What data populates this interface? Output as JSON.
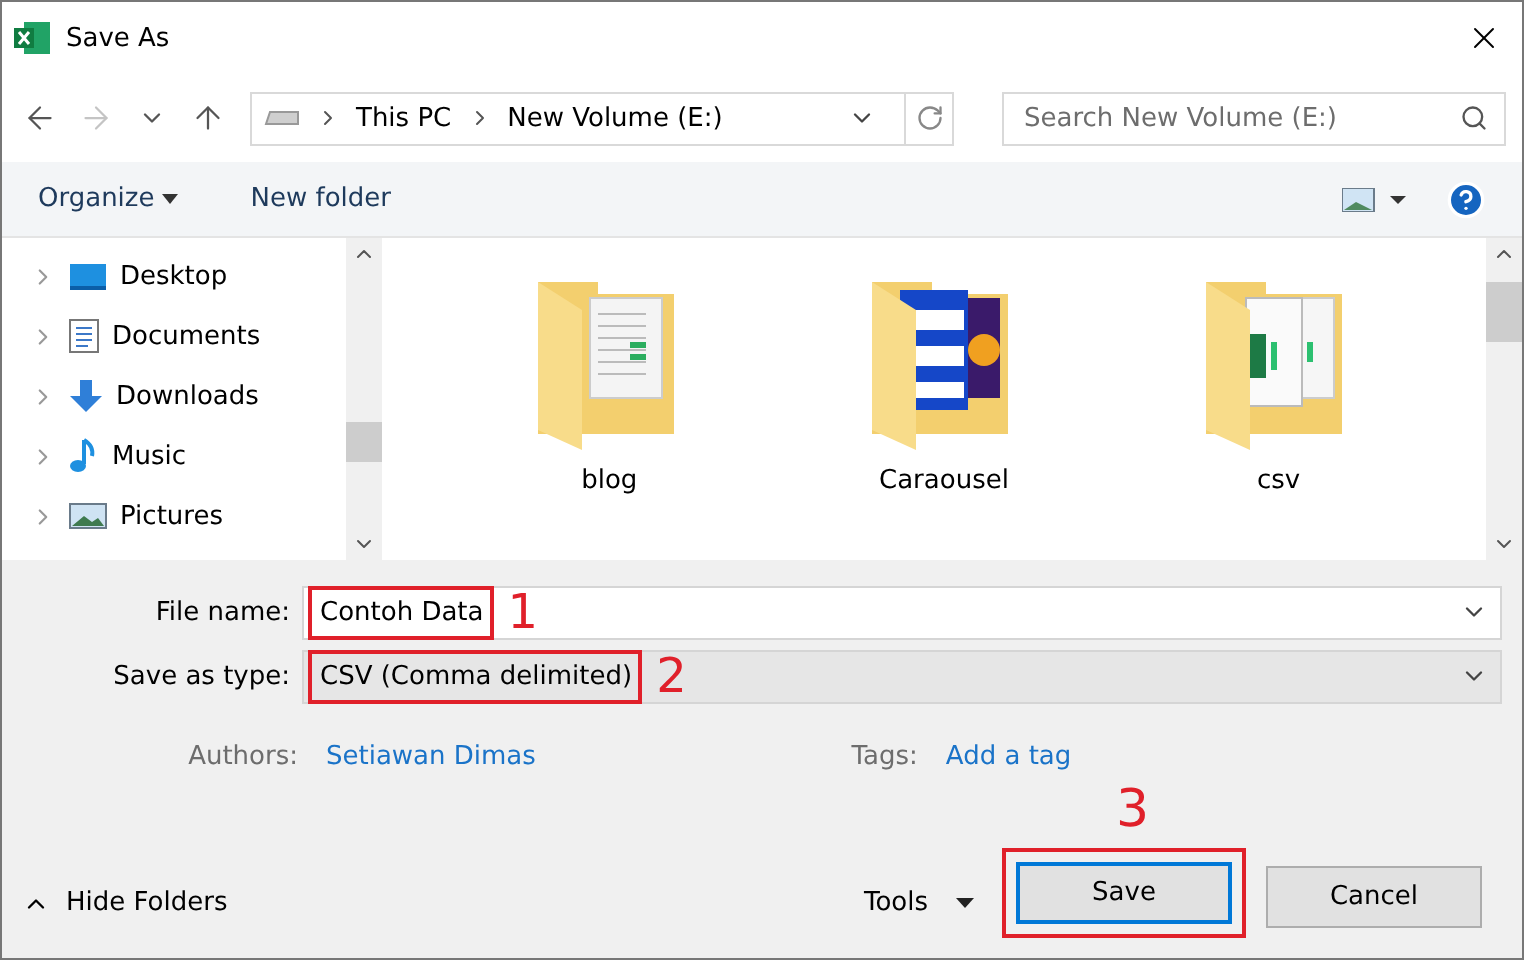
{
  "window": {
    "title": "Save As"
  },
  "navigation": {
    "forward_disabled": true,
    "path": [
      "This PC",
      "New Volume (E:)"
    ]
  },
  "search": {
    "placeholder": "Search New Volume (E:)"
  },
  "toolbar": {
    "organize": "Organize",
    "new_folder": "New folder"
  },
  "sidebar": {
    "items": [
      {
        "label": "Desktop",
        "kind": "desktop"
      },
      {
        "label": "Documents",
        "kind": "documents"
      },
      {
        "label": "Downloads",
        "kind": "downloads"
      },
      {
        "label": "Music",
        "kind": "music"
      },
      {
        "label": "Pictures",
        "kind": "pictures"
      }
    ]
  },
  "folders": [
    {
      "name": "blog",
      "kind": "document"
    },
    {
      "name": "Caraousel",
      "kind": "slides"
    },
    {
      "name": "csv",
      "kind": "spreadsheet"
    }
  ],
  "form": {
    "file_name": {
      "label": "File name:",
      "value": "Contoh Data",
      "annotation": "1"
    },
    "save_as_type": {
      "label": "Save as type:",
      "value": "CSV (Comma delimited)",
      "annotation": "2"
    },
    "authors": {
      "label": "Authors:",
      "value": "Setiawan Dimas"
    },
    "tags": {
      "label": "Tags:",
      "value": "Add a tag"
    }
  },
  "footer": {
    "hide_folders": "Hide Folders",
    "tools": "Tools",
    "save": "Save",
    "save_annotation": "3",
    "cancel": "Cancel"
  }
}
